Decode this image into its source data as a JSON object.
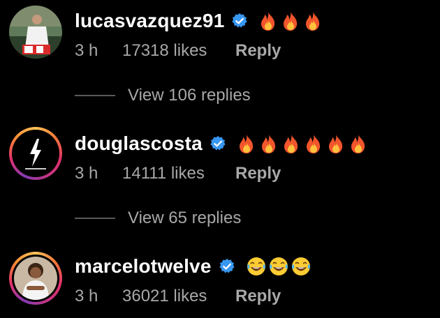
{
  "comments": [
    {
      "username": "lucasvazquez91",
      "verified": true,
      "emoji_icon": "fire-emoji",
      "emoji_count": 3,
      "time": "3 h",
      "likes": "17318 likes",
      "reply_label": "Reply",
      "view_replies": "View 106 replies",
      "avatar_style": "photo"
    },
    {
      "username": "douglascosta",
      "verified": true,
      "emoji_icon": "fire-emoji",
      "emoji_count": 6,
      "time": "3 h",
      "likes": "14111 likes",
      "reply_label": "Reply",
      "view_replies": "View 65 replies",
      "avatar_style": "story-ring-logo"
    },
    {
      "username": "marcelotwelve",
      "verified": true,
      "emoji_icon": "tears-of-joy-emoji",
      "emoji_count": 3,
      "time": "3 h",
      "likes": "36021 likes",
      "reply_label": "Reply",
      "avatar_style": "story-ring-photo"
    }
  ],
  "colors": {
    "background": "#000000",
    "username": "#ffffff",
    "meta": "#a8a8a8",
    "verified_badge": "#3897f0",
    "story_ring_start": "#fdc35a",
    "story_ring_end": "#e1306c"
  }
}
